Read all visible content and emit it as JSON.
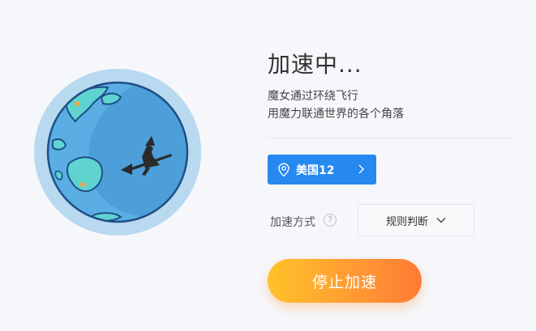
{
  "status": {
    "title": "加速中..."
  },
  "slogan": {
    "line1": "魔女通过环绕飞行",
    "line2": "用魔力联通世界的各个角落"
  },
  "node": {
    "name": "美国12",
    "icon": "location-pin-icon",
    "chevron": "chevron-right-icon"
  },
  "mode": {
    "label": "加速方式",
    "help_icon": "question-icon",
    "help_glyph": "?",
    "selected": "规则判断",
    "dropdown_icon": "chevron-down-icon"
  },
  "action": {
    "stop_label": "停止加速"
  },
  "colors": {
    "node_button": "#2589f0",
    "stop_gradient_start": "#ffc228",
    "stop_gradient_end": "#ff7a35",
    "globe_ring": "#b8d9ef",
    "globe_ocean": "#4d9fd9"
  }
}
